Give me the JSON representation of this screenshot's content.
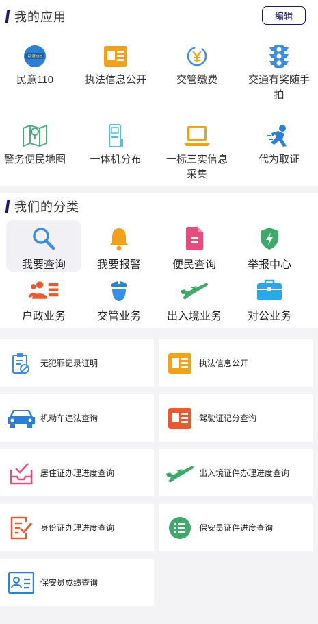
{
  "my_apps": {
    "title": "我的应用",
    "edit_label": "编辑",
    "items": [
      {
        "label": "民意110",
        "icon": "minyi110-icon"
      },
      {
        "label": "执法信息公开",
        "icon": "news-card-icon"
      },
      {
        "label": "交管缴费",
        "icon": "yen-payment-icon"
      },
      {
        "label": "交通有奖随手拍",
        "icon": "traffic-light-icon"
      },
      {
        "label": "警务便民地图",
        "icon": "map-pin-icon"
      },
      {
        "label": "一体机分布",
        "icon": "kiosk-icon"
      },
      {
        "label": "一标三实信息采集",
        "icon": "laptop-icon"
      },
      {
        "label": "代为取证",
        "icon": "running-person-icon"
      }
    ],
    "badge_text": "民意110"
  },
  "categories": {
    "title": "我们的分类",
    "items": [
      {
        "label": "我要查询",
        "icon": "search-icon",
        "active": true
      },
      {
        "label": "我要报警",
        "icon": "bell-icon"
      },
      {
        "label": "便民查询",
        "icon": "document-icon"
      },
      {
        "label": "举报中心",
        "icon": "shield-bolt-icon"
      },
      {
        "label": "户政业务",
        "icon": "people-list-icon"
      },
      {
        "label": "交管业务",
        "icon": "police-officer-icon"
      },
      {
        "label": "出入境业务",
        "icon": "airplane-icon"
      },
      {
        "label": "对公业务",
        "icon": "briefcase-icon"
      }
    ]
  },
  "services": [
    {
      "label": "无犯罪记录证明",
      "icon": "clipboard-no-icon"
    },
    {
      "label": "执法信息公开",
      "icon": "news-card-icon"
    },
    {
      "label": "机动车违法查询",
      "icon": "car-icon"
    },
    {
      "label": "驾驶证记分查询",
      "icon": "license-card-icon"
    },
    {
      "label": "居住证办理进度查询",
      "icon": "inbox-check-icon"
    },
    {
      "label": "出入境证件办理进度查询",
      "icon": "airplane-icon"
    },
    {
      "label": "身份证办理进度查询",
      "icon": "checklist-edit-icon"
    },
    {
      "label": "保安员证件进度查询",
      "icon": "list-circle-icon"
    },
    {
      "label": "保安员成绩查询",
      "icon": "id-card-icon"
    }
  ],
  "colors": {
    "accent": "#1b1a6e",
    "orange": "#f0a21a",
    "blue": "#3a8ee6",
    "red": "#ea5a2e",
    "pink": "#e64c7c",
    "green": "#3fa96b"
  }
}
